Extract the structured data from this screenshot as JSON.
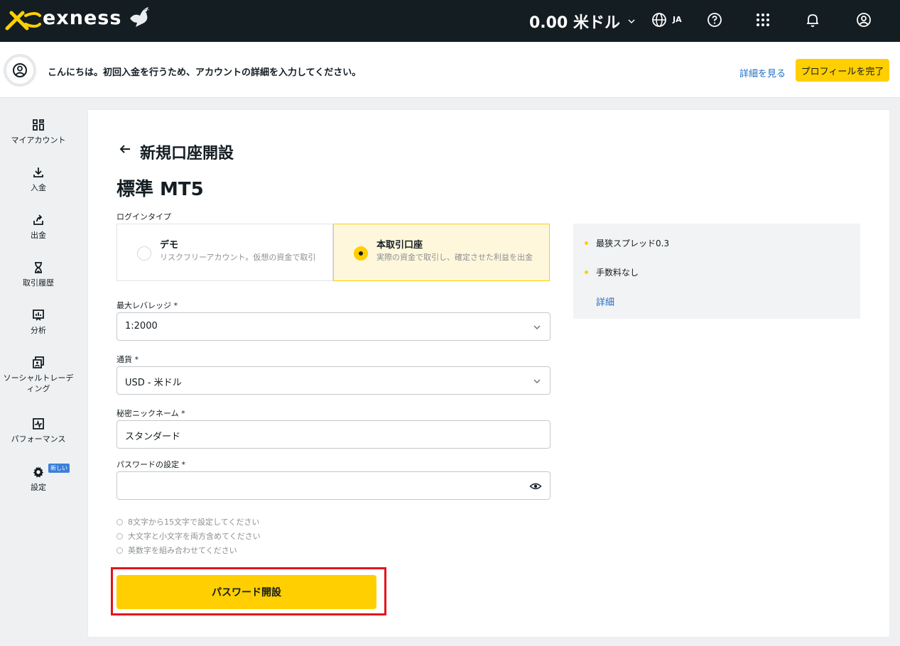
{
  "header": {
    "brand": "exness",
    "balance": "0.00 米ドル",
    "language": "JA",
    "icons": [
      "globe-icon",
      "help-icon",
      "apps-grid-icon",
      "bell-icon",
      "user-icon"
    ]
  },
  "notice": {
    "text": "こんにちは。初回入金を行うため、アカウントの詳細を入力してください。",
    "link": "詳細を見る",
    "button": "プロフィールを完了"
  },
  "sidebar": {
    "items": [
      {
        "label": "マイアカウント",
        "icon": "dashboard-icon"
      },
      {
        "label": "入金",
        "icon": "deposit-icon"
      },
      {
        "label": "出金",
        "icon": "withdraw-icon"
      },
      {
        "label": "取引履歴",
        "icon": "hourglass-icon"
      },
      {
        "label": "分析",
        "icon": "analytics-icon"
      },
      {
        "label": "ソーシャルトレーディング",
        "icon": "social-trading-icon"
      },
      {
        "label": "パフォーマンス",
        "icon": "performance-icon"
      },
      {
        "label": "設定",
        "icon": "gear-icon",
        "badge": "新しい"
      }
    ]
  },
  "form": {
    "page_title": "新規口座開設",
    "account_title": "標準 MT5",
    "login_type_label": "ログインタイプ",
    "login_options": [
      {
        "title": "デモ",
        "desc": "リスクフリーアカウント。仮想の資金で取引",
        "selected": false
      },
      {
        "title": "本取引口座",
        "desc": "実際の資金で取引し、確定させた利益を出金",
        "selected": true
      }
    ],
    "leverage_label": "最大レバレッジ *",
    "leverage_value": "1:2000",
    "currency_label": "通貨 *",
    "currency_value": "USD - 米ドル",
    "nickname_label": "秘密ニックネーム *",
    "nickname_value": "スタンダード",
    "password_label": "パスワードの設定 *",
    "password_value": "",
    "password_rules": [
      "8文字から15文字で設定してください",
      "大文字と小文字を両方含めてください",
      "英数字を組み合わせてください"
    ],
    "submit": "パスワード開設"
  },
  "info": {
    "items": [
      "最狭スプレッド0.3",
      "手数料なし"
    ],
    "link": "詳細"
  },
  "colors": {
    "accent": "#ffcf01",
    "topbar": "#141d22",
    "link": "#1f6fc5",
    "highlight": "#e3151b"
  }
}
